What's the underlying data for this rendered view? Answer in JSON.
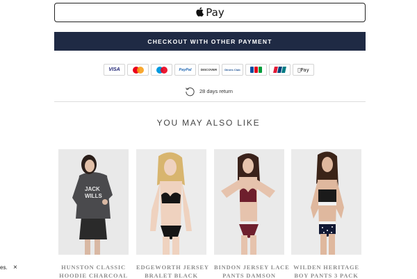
{
  "applepay": {
    "label": "Pay"
  },
  "checkout": {
    "label": "CHECKOUT WITH OTHER PAYMENT"
  },
  "payment_icons": [
    {
      "name": "visa-icon",
      "label": "VISA"
    },
    {
      "name": "mastercard-icon",
      "label": ""
    },
    {
      "name": "maestro-icon",
      "label": ""
    },
    {
      "name": "paypal-icon",
      "label": "PayPal"
    },
    {
      "name": "discover-icon",
      "label": "DISCOVER"
    },
    {
      "name": "diners-club-icon",
      "label": "Diners Club"
    },
    {
      "name": "jcb-icon",
      "label": ""
    },
    {
      "name": "unionpay-icon",
      "label": ""
    },
    {
      "name": "apple-pay-icon",
      "label": "Pay"
    }
  ],
  "returns": {
    "label": "28 days return"
  },
  "recommendations": {
    "title": "YOU MAY ALSO LIKE",
    "products": [
      {
        "name_line1": "HUNSTON CLASSIC",
        "name_line2": "HOODIE CHARCOAL"
      },
      {
        "name_line1": "EDGEWORTH JERSEY",
        "name_line2": "BRALET BLACK"
      },
      {
        "name_line1": "BINDON JERSEY LACE",
        "name_line2": "PANTS DAMSON"
      },
      {
        "name_line1": "WILDEN HERITAGE",
        "name_line2": "BOY PANTS 3 PACK"
      }
    ]
  },
  "cookie_banner": {
    "text_fragment": "es.",
    "close": "×"
  },
  "colors": {
    "primary": "#1f2a44",
    "visa": "#1a1f71",
    "mastercard_red": "#eb001b",
    "mastercard_orange": "#f79e1b",
    "maestro_blue": "#0099df",
    "paypal": "#1f66b2",
    "background": "#ffffff"
  }
}
